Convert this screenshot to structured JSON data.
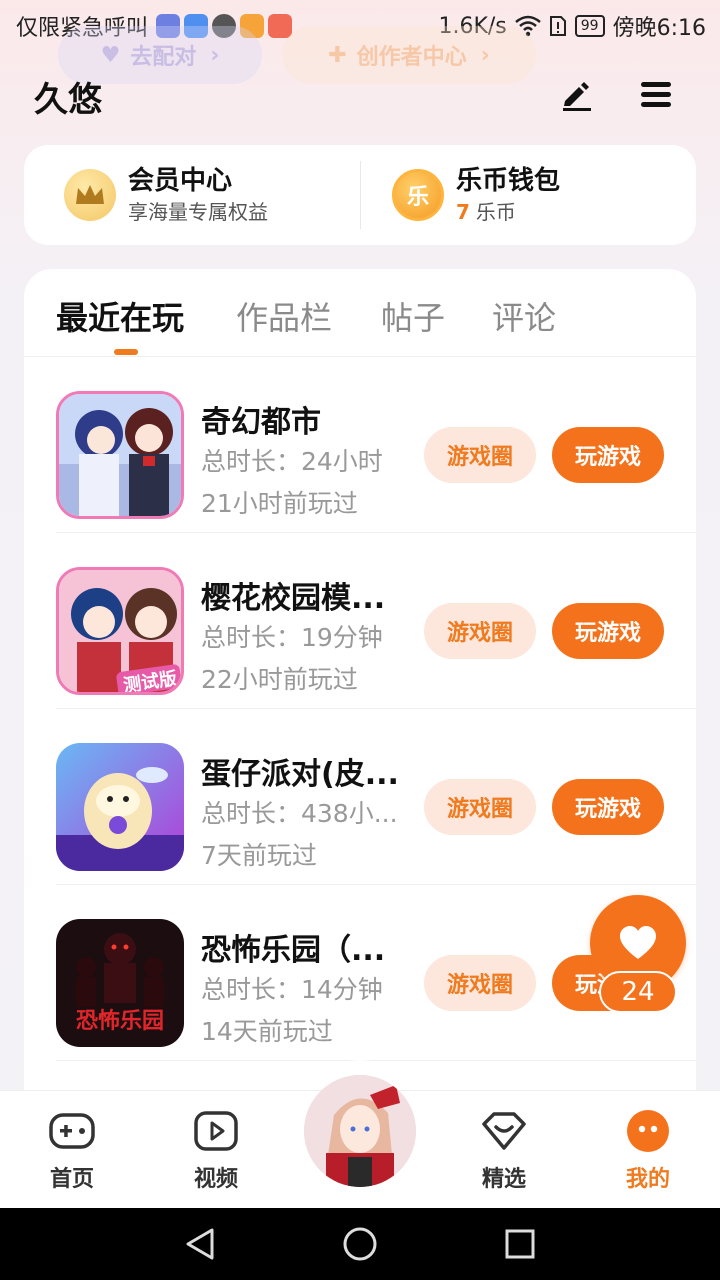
{
  "status_bar": {
    "carrier_text": "仅限紧急呼叫",
    "speed": "1.6K/s",
    "battery": "99",
    "time": "傍晚6:16"
  },
  "background_chips": {
    "pair": "去配对",
    "creator": "创作者中心"
  },
  "header": {
    "title": "久悠"
  },
  "member": {
    "vip_title": "会员中心",
    "vip_sub": "享海量专属权益",
    "wallet_title": "乐币钱包",
    "wallet_amount": "7",
    "wallet_unit": "乐币",
    "coin_glyph": "乐"
  },
  "tabs": [
    "最近在玩",
    "作品栏",
    "帖子",
    "评论"
  ],
  "games": [
    {
      "name": "奇幻都市",
      "duration": "总时长：24小时",
      "last": "21小时前玩过",
      "circle": "游戏圈",
      "play": "玩游戏"
    },
    {
      "name": "樱花校园模...",
      "duration": "总时长：19分钟",
      "last": "22小时前玩过",
      "circle": "游戏圈",
      "play": "玩游戏"
    },
    {
      "name": "蛋仔派对(皮...",
      "duration": "总时长：438小...",
      "last": "7天前玩过",
      "circle": "游戏圈",
      "play": "玩游戏"
    },
    {
      "name": "恐怖乐园（...",
      "duration": "总时长：14分钟",
      "last": "14天前玩过",
      "circle": "游戏圈",
      "play": "玩游戏"
    }
  ],
  "thumb_texts": {
    "test_version": "测试版",
    "horror_logo": "恐怖乐园"
  },
  "like": {
    "count": "24"
  },
  "nav": {
    "home": "首页",
    "video": "视频",
    "featured": "精选",
    "mine": "我的"
  },
  "colors": {
    "accent": "#f5721c",
    "accent_light": "#fde7dc"
  }
}
